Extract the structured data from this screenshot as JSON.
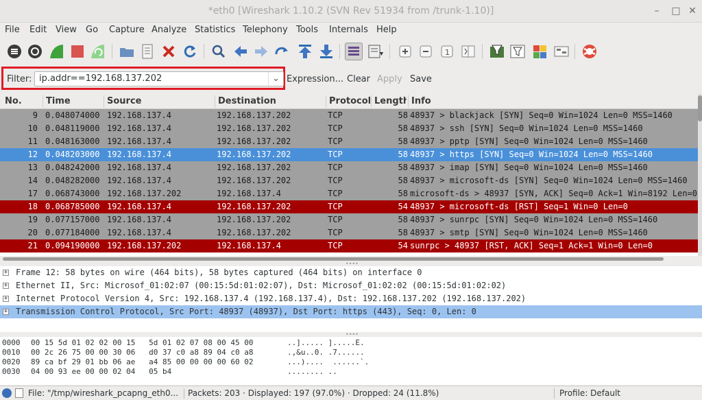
{
  "window": {
    "title": "*eth0   [Wireshark 1.10.2  (SVN Rev 51934 from /trunk-1.10)]"
  },
  "menu": [
    "File",
    "Edit",
    "View",
    "Go",
    "Capture",
    "Analyze",
    "Statistics",
    "Telephony",
    "Tools",
    "Internals",
    "Help"
  ],
  "toolbar": {
    "icons": [
      "interfaces-icon",
      "options-icon",
      "start-capture-icon",
      "stop-capture-icon",
      "restart-capture-icon",
      "open-file-icon",
      "save-file-icon",
      "close-file-icon",
      "reload-icon",
      "find-icon",
      "back-icon",
      "forward-icon",
      "goto-packet-icon",
      "first-packet-icon",
      "last-packet-icon",
      "colorize-icon",
      "autoscroll-icon",
      "zoom-in-icon",
      "zoom-out-icon",
      "normal-size-icon",
      "resize-columns-icon",
      "capture-filters-icon",
      "display-filters-icon",
      "coloring-rules-icon",
      "preferences-icon",
      "help-icon"
    ]
  },
  "filter": {
    "label": "Filter:",
    "value": "ip.addr==192.168.137.202",
    "expression": "Expression...",
    "clear": "Clear",
    "apply": "Apply",
    "save": "Save",
    "highlight_color": "#e01b24"
  },
  "packet_list": {
    "columns": [
      "No.",
      "Time",
      "Source",
      "Destination",
      "Protocol",
      "Length",
      "Info"
    ],
    "rows": [
      {
        "no": "9",
        "time": "0.048074000",
        "src": "192.168.137.4",
        "dst": "192.168.137.202",
        "proto": "TCP",
        "len": "58",
        "info": "48937 > blackjack [SYN] Seq=0 Win=1024 Len=0 MSS=1460",
        "style": "gray"
      },
      {
        "no": "10",
        "time": "0.048119000",
        "src": "192.168.137.4",
        "dst": "192.168.137.202",
        "proto": "TCP",
        "len": "58",
        "info": "48937 > ssh [SYN] Seq=0 Win=1024 Len=0 MSS=1460",
        "style": "gray"
      },
      {
        "no": "11",
        "time": "0.048163000",
        "src": "192.168.137.4",
        "dst": "192.168.137.202",
        "proto": "TCP",
        "len": "58",
        "info": "48937 > pptp [SYN] Seq=0 Win=1024 Len=0 MSS=1460",
        "style": "gray"
      },
      {
        "no": "12",
        "time": "0.048203000",
        "src": "192.168.137.4",
        "dst": "192.168.137.202",
        "proto": "TCP",
        "len": "58",
        "info": "48937 > https [SYN] Seq=0 Win=1024 Len=0 MSS=1460",
        "style": "sel"
      },
      {
        "no": "13",
        "time": "0.048242000",
        "src": "192.168.137.4",
        "dst": "192.168.137.202",
        "proto": "TCP",
        "len": "58",
        "info": "48937 > imap [SYN] Seq=0 Win=1024 Len=0 MSS=1460",
        "style": "gray"
      },
      {
        "no": "14",
        "time": "0.048282000",
        "src": "192.168.137.4",
        "dst": "192.168.137.202",
        "proto": "TCP",
        "len": "58",
        "info": "48937 > microsoft-ds [SYN] Seq=0 Win=1024 Len=0 MSS=1460",
        "style": "gray"
      },
      {
        "no": "17",
        "time": "0.068743000",
        "src": "192.168.137.202",
        "dst": "192.168.137.4",
        "proto": "TCP",
        "len": "58",
        "info": "microsoft-ds > 48937 [SYN, ACK] Seq=0 Ack=1 Win=8192 Len=0",
        "style": "gray"
      },
      {
        "no": "18",
        "time": "0.068785000",
        "src": "192.168.137.4",
        "dst": "192.168.137.202",
        "proto": "TCP",
        "len": "54",
        "info": "48937 > microsoft-ds [RST] Seq=1 Win=0 Len=0",
        "style": "red"
      },
      {
        "no": "19",
        "time": "0.077157000",
        "src": "192.168.137.4",
        "dst": "192.168.137.202",
        "proto": "TCP",
        "len": "58",
        "info": "48937 > sunrpc [SYN] Seq=0 Win=1024 Len=0 MSS=1460",
        "style": "gray"
      },
      {
        "no": "20",
        "time": "0.077184000",
        "src": "192.168.137.4",
        "dst": "192.168.137.202",
        "proto": "TCP",
        "len": "58",
        "info": "48937 > smtp [SYN] Seq=0 Win=1024 Len=0 MSS=1460",
        "style": "gray"
      },
      {
        "no": "21",
        "time": "0.094190000",
        "src": "192.168.137.202",
        "dst": "192.168.137.4",
        "proto": "TCP",
        "len": "54",
        "info": "sunrpc > 48937 [RST, ACK] Seq=1 Ack=1 Win=0 Len=0",
        "style": "red"
      }
    ]
  },
  "details": [
    {
      "text": "Frame 12: 58 bytes on wire (464 bits), 58 bytes captured (464 bits) on interface 0",
      "selected": false
    },
    {
      "text": "Ethernet II, Src: Microsof_01:02:07 (00:15:5d:01:02:07), Dst: Microsof_01:02:02 (00:15:5d:01:02:02)",
      "selected": false
    },
    {
      "text": "Internet Protocol Version 4, Src: 192.168.137.4 (192.168.137.4), Dst: 192.168.137.202 (192.168.137.202)",
      "selected": false
    },
    {
      "text": "Transmission Control Protocol, Src Port: 48937 (48937), Dst Port: https (443), Seq: 0, Len: 0",
      "selected": true
    }
  ],
  "bytes": [
    {
      "offset": "0000",
      "hex": "00 15 5d 01 02 02 00 15   5d 01 02 07 08 00 45 00",
      "ascii": "..]..... ].....E."
    },
    {
      "offset": "0010",
      "hex": "00 2c 26 75 00 00 30 06   d0 37 c0 a8 89 04 c0 a8",
      "ascii": ".,&u..0. .7......"
    },
    {
      "offset": "0020",
      "hex": "89 ca bf 29 01 bb 06 ae   a4 85 00 00 00 00 60 02",
      "ascii": "...)....  ......`."
    },
    {
      "offset": "0030",
      "hex": "04 00 93 ee 00 00 02 04   05 b4",
      "ascii": "........ .."
    }
  ],
  "status": {
    "file": "File: \"/tmp/wireshark_pcapng_eth0...",
    "packets": "Packets: 203 · Displayed: 197 (97.0%) · Dropped: 24 (11.8%)",
    "profile": "Profile: Default"
  }
}
